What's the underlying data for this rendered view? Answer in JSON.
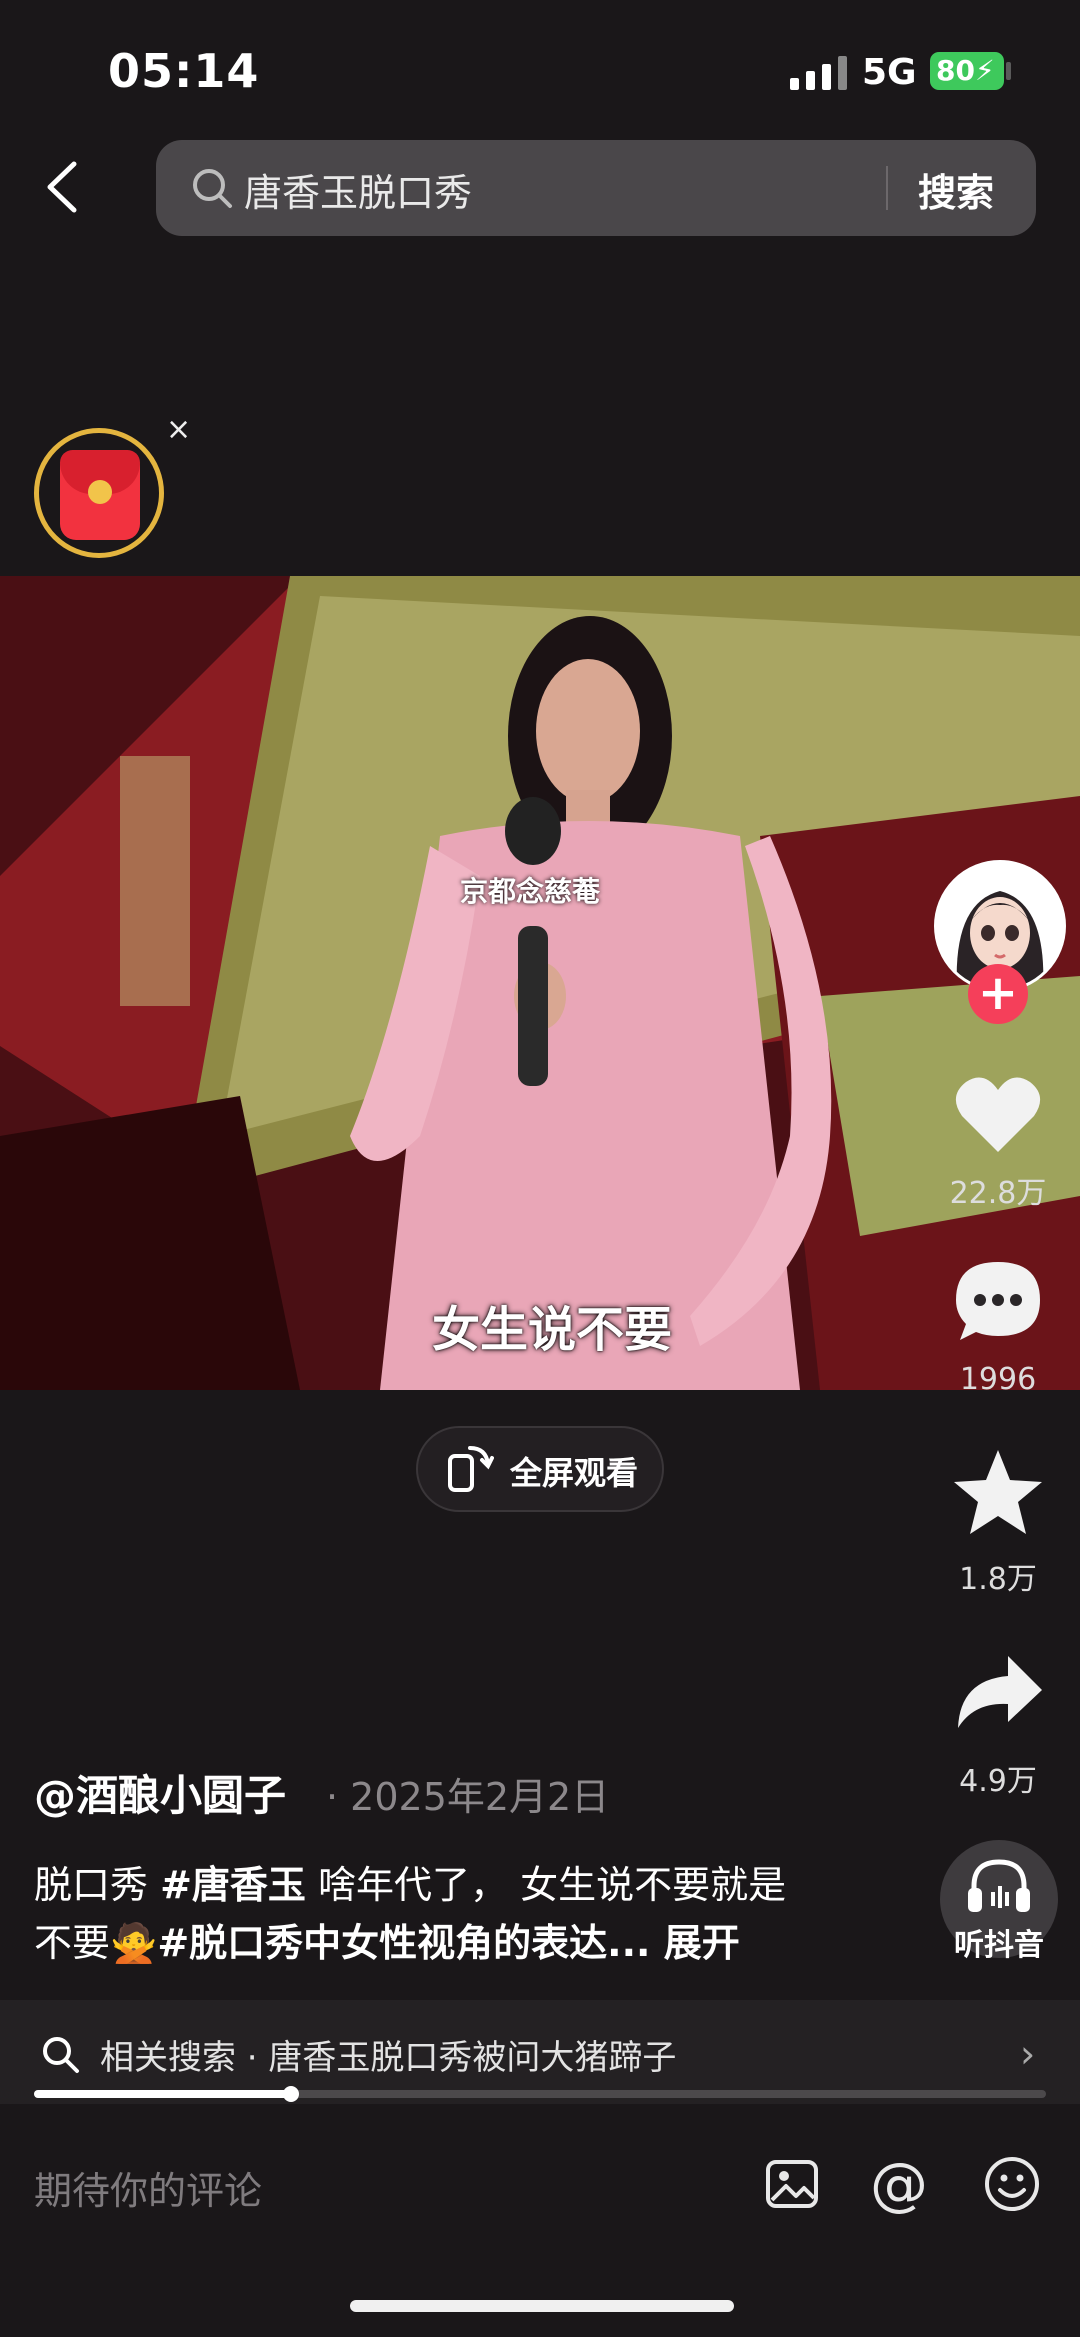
{
  "status": {
    "time": "05:14",
    "network": "5G",
    "battery": "80"
  },
  "search": {
    "query": "唐香玉脱口秀",
    "button_label": "搜索"
  },
  "packet": {
    "close_label": "×"
  },
  "video": {
    "caption": "女生说不要",
    "overlay_text": "京都念慈菴",
    "fullscreen_label": "全屏观看"
  },
  "rail": {
    "follow_label": "+",
    "likes": "22.8万",
    "comments": "1996",
    "favorites": "1.8万",
    "shares": "4.9万",
    "listen_label": "听抖音"
  },
  "post": {
    "author": "@酒酿小圆子",
    "date": "· 2025年2月2日",
    "desc_part1": "脱口秀 ",
    "tag1": "#唐香玉",
    "desc_part2": " 啥年代了， 女生说不要就是",
    "desc_part3": "不要🙅",
    "tag2": "#脱口秀中女性视角的表达...",
    "expand_label": " 展开"
  },
  "related": {
    "label": "相关搜索 · 唐香玉脱口秀被问大猪蹄子",
    "arrow": "›"
  },
  "progress": {
    "fraction": 0.254
  },
  "comment": {
    "placeholder": "期待你的评论",
    "at_label": "@"
  },
  "colors": {
    "accent_red": "#f53f5a",
    "battery_green": "#3ec95c",
    "ring_gold": "#e4b53f"
  },
  "icons": [
    "back-icon",
    "search-icon",
    "red-packet-icon",
    "fullscreen-icon",
    "heart-icon",
    "comment-icon",
    "star-icon",
    "share-icon",
    "headphones-icon",
    "image-icon",
    "at-icon",
    "emoji-icon"
  ]
}
